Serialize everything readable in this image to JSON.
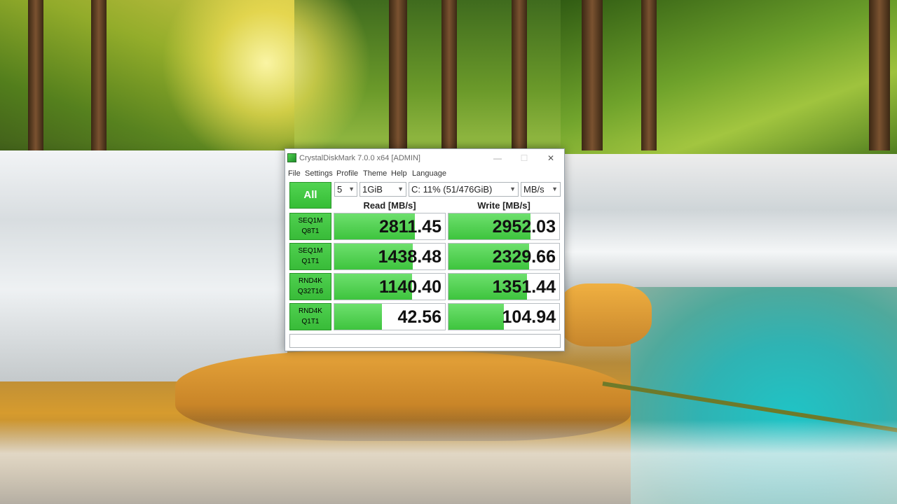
{
  "window": {
    "title": "CrystalDiskMark 7.0.0 x64 [ADMIN]",
    "minimize_glyph": "—",
    "maximize_glyph": "☐",
    "close_glyph": "✕"
  },
  "menu": [
    "File",
    "Settings",
    "Profile",
    "Theme",
    "Help",
    "Language"
  ],
  "controls": {
    "all_label": "All",
    "count": "5",
    "size": "1GiB",
    "drive": "C: 11% (51/476GiB)",
    "unit": "MB/s"
  },
  "columns": {
    "read": "Read [MB/s]",
    "write": "Write [MB/s]"
  },
  "rows": [
    {
      "label1": "SEQ1M",
      "label2": "Q8T1",
      "read": "2811.45",
      "write": "2952.03",
      "read_fill": 0.73,
      "write_fill": 0.74
    },
    {
      "label1": "SEQ1M",
      "label2": "Q1T1",
      "read": "1438.48",
      "write": "2329.66",
      "read_fill": 0.71,
      "write_fill": 0.73
    },
    {
      "label1": "RND4K",
      "label2": "Q32T16",
      "read": "1140.40",
      "write": "1351.44",
      "read_fill": 0.7,
      "write_fill": 0.71
    },
    {
      "label1": "RND4K",
      "label2": "Q1T1",
      "read": "42.56",
      "write": "104.94",
      "read_fill": 0.43,
      "write_fill": 0.5
    }
  ],
  "status": "",
  "icons": {
    "app": "crystaldiskmark-icon",
    "chevron": "chevron-down-icon"
  }
}
